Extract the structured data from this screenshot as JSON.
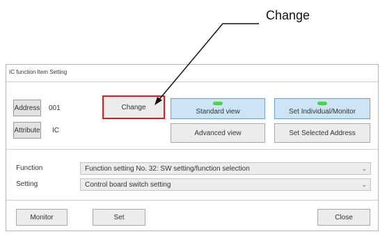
{
  "callout": {
    "label": "Change"
  },
  "window": {
    "title": "IC function Item Setting"
  },
  "address": {
    "label": "Address",
    "value": "001"
  },
  "attribute": {
    "label": "Attribute",
    "value": "IC"
  },
  "buttons": {
    "change": "Change",
    "standard_view": "Standard view",
    "set_individual_monitor": "Set Individual/Monitor",
    "advanced_view": "Advanced view",
    "set_selected_address": "Set Selected Address",
    "monitor": "Monitor",
    "set": "Set",
    "close": "Close"
  },
  "function": {
    "label": "Function",
    "selected": "Function setting No. 32: SW setting/function selection"
  },
  "setting": {
    "label": "Setting",
    "selected": "Control board switch setting"
  },
  "colors": {
    "highlight": "#e01b1b",
    "led": "#4fcf4f",
    "selected_button": "#cde4f7"
  },
  "icons": {
    "dropdown": "chevron-down-icon",
    "indicator": "status-led-icon"
  }
}
